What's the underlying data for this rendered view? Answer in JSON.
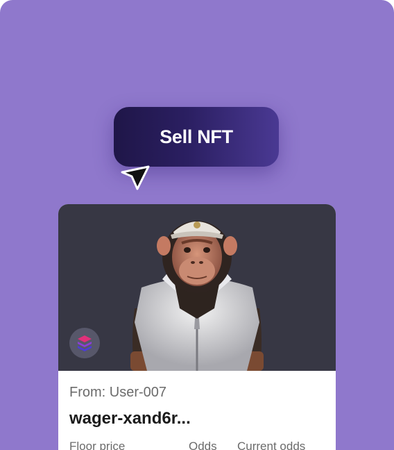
{
  "cta": {
    "label": "Sell NFT"
  },
  "card": {
    "from_text": "From: User-007",
    "name": "wager-xand6r...",
    "stats_labels": [
      "Floor price",
      "Odds",
      "Current odds"
    ]
  },
  "icons": {
    "cursor": "cursor-arrow-icon",
    "chain": "layered-chain-logo-icon"
  },
  "colors": {
    "background": "#8f78cc",
    "button_dark": "#1f1648",
    "button_light": "#4a3993",
    "card_image_bg": "#373744"
  }
}
